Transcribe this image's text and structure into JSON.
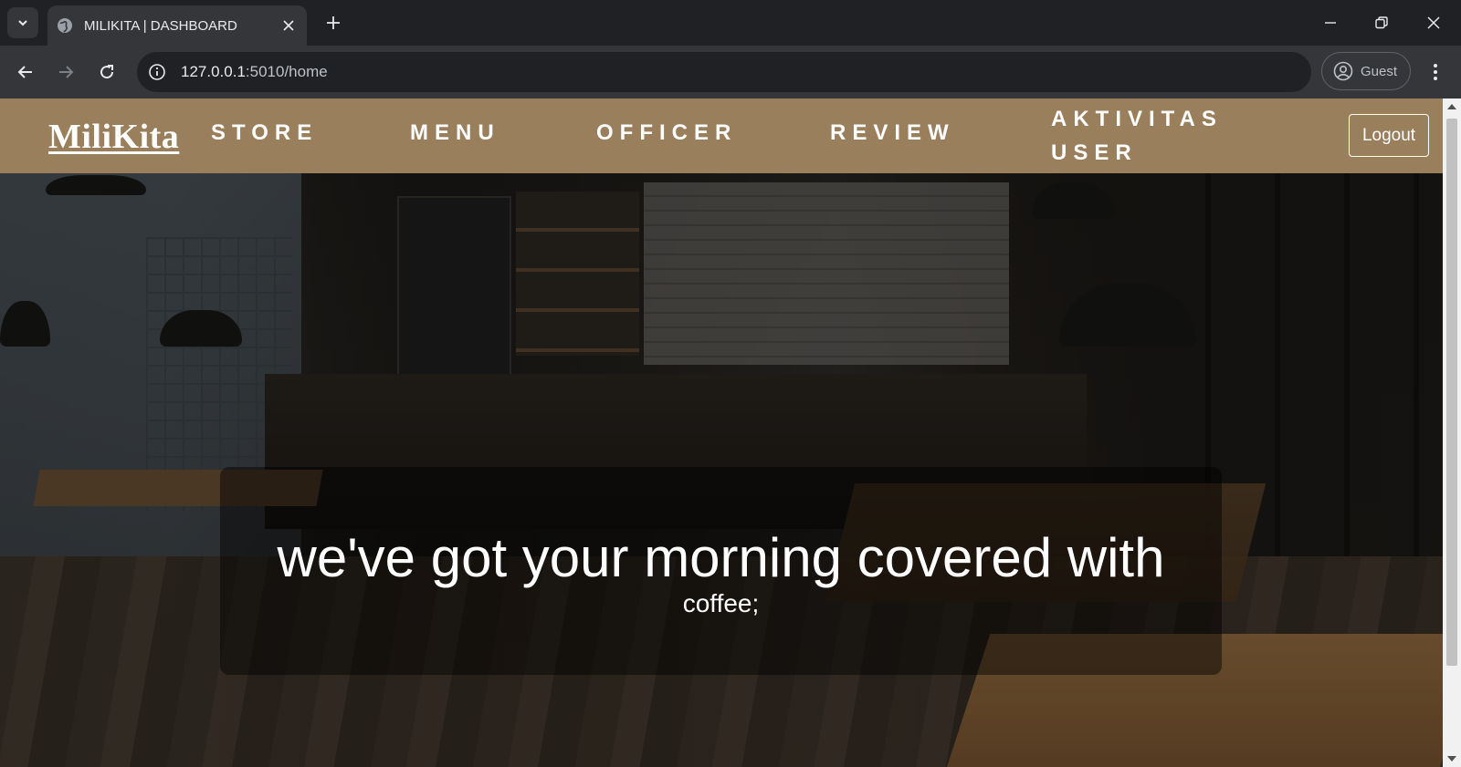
{
  "browser": {
    "tab_title": "MILIKITA | DASHBOARD",
    "url_host": "127.0.0.1",
    "url_path": ":5010/home",
    "profile_label": "Guest"
  },
  "navbar": {
    "brand": "MiliKita",
    "links": [
      {
        "label": "STORE"
      },
      {
        "label": "MENU"
      },
      {
        "label": "OFFICER"
      },
      {
        "label": "REVIEW"
      },
      {
        "label_line1": "AKTIVITAS",
        "label_line2": "USER"
      }
    ],
    "logout_label": "Logout",
    "background_color": "#9a7f5c"
  },
  "hero": {
    "headline": "we've got your morning covered with",
    "subline": "coffee;"
  }
}
